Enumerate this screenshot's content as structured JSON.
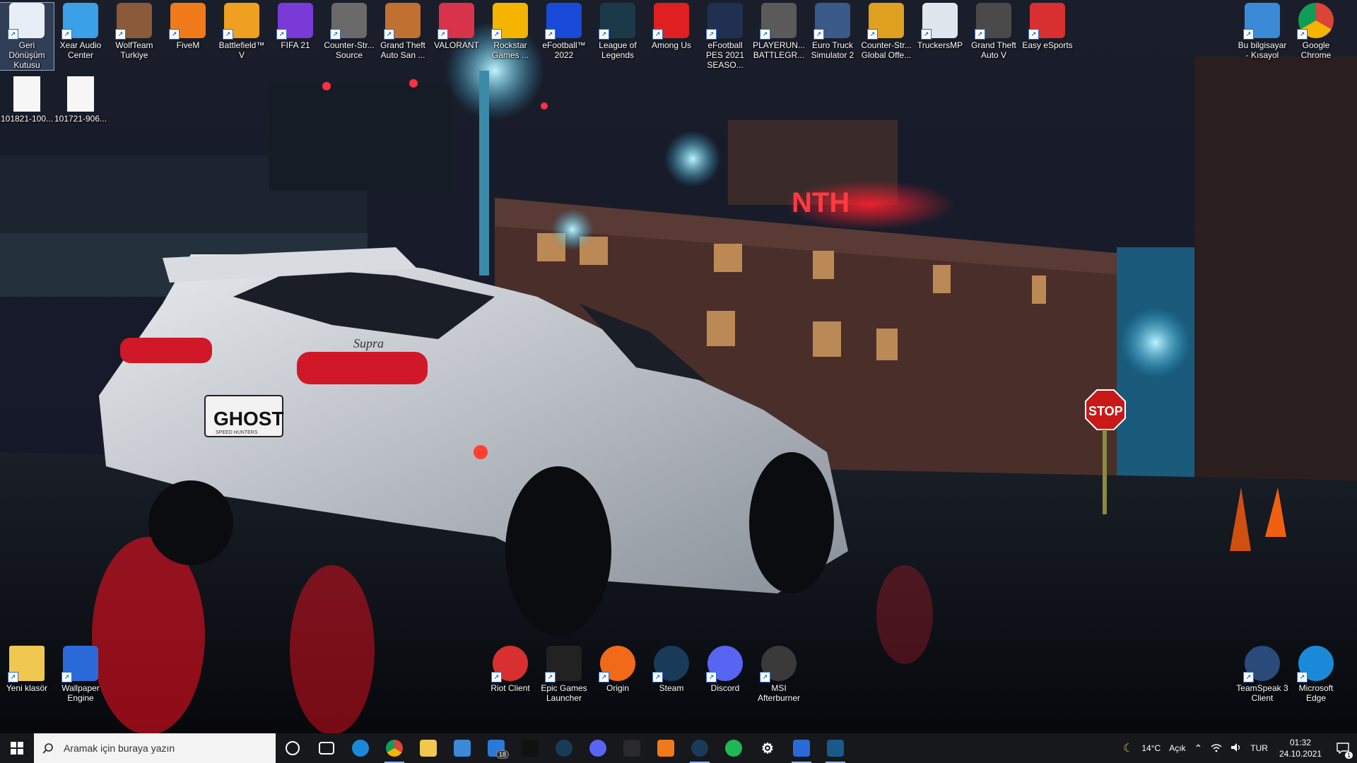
{
  "desktop": {
    "top_icons": [
      {
        "label": "Geri Dönüşüm Kutusu",
        "icon": "recycle-bin-icon",
        "color": "#e8eef5"
      },
      {
        "label": "Xear Audio Center",
        "icon": "xear-audio-icon",
        "color": "#3aa0e8"
      },
      {
        "label": "WolfTeam Turkiye",
        "icon": "wolfteam-icon",
        "color": "#8a5a3a"
      },
      {
        "label": "FiveM",
        "icon": "fivem-icon",
        "color": "#f07a1a"
      },
      {
        "label": "Battlefield™ V",
        "icon": "battlefield-icon",
        "color": "#f0a020"
      },
      {
        "label": "FIFA 21",
        "icon": "fifa-icon",
        "color": "#7a3ad8"
      },
      {
        "label": "Counter-Str... Source",
        "icon": "counter-strike-source-icon",
        "color": "#6a6a6a"
      },
      {
        "label": "Grand Theft Auto San ...",
        "icon": "gta-san-andreas-icon",
        "color": "#c07030"
      },
      {
        "label": "VALORANT",
        "icon": "valorant-icon",
        "color": "#d8334a"
      },
      {
        "label": "Rockstar Games ...",
        "icon": "rockstar-games-icon",
        "color": "#f5b400"
      },
      {
        "label": "eFootball™ 2022",
        "icon": "efootball-icon",
        "color": "#1a4ad8"
      },
      {
        "label": "League of Legends",
        "icon": "league-of-legends-icon",
        "color": "#1a3a4a"
      },
      {
        "label": "Among Us",
        "icon": "among-us-icon",
        "color": "#e02020"
      },
      {
        "label": "eFootball PES 2021 SEASO...",
        "icon": "pes-2021-icon",
        "color": "#203050"
      },
      {
        "label": "PLAYERUN... BATTLEGR...",
        "icon": "pubg-icon",
        "color": "#5a5a5a"
      },
      {
        "label": "Euro Truck Simulator 2",
        "icon": "euro-truck-icon",
        "color": "#3a5a8a"
      },
      {
        "label": "Counter-Str... Global Offe...",
        "icon": "csgo-icon",
        "color": "#e0a020"
      },
      {
        "label": "TruckersMP",
        "icon": "truckersmp-icon",
        "color": "#dfe6ee"
      },
      {
        "label": "Grand Theft Auto V",
        "icon": "gta-v-icon",
        "color": "#4a4a4a"
      },
      {
        "label": "Easy eSports",
        "icon": "easy-esports-icon",
        "color": "#d83030"
      }
    ],
    "right_icons": [
      {
        "label": "Bu bilgisayar - Kısayol",
        "icon": "this-pc-icon",
        "color": "#3a8ad8"
      },
      {
        "label": "Google Chrome",
        "icon": "chrome-icon",
        "color": "#ffffff"
      }
    ],
    "file_icons": [
      {
        "label": "101821-100...",
        "icon": "file-icon"
      },
      {
        "label": "101721-906...",
        "icon": "file-icon"
      }
    ],
    "bottom_left_icons": [
      {
        "label": "Yeni klasör",
        "icon": "folder-icon",
        "color": "#f0c850"
      },
      {
        "label": "Wallpaper Engine",
        "icon": "wallpaper-engine-icon",
        "color": "#2a6ad8"
      }
    ],
    "bottom_center_icons": [
      {
        "label": "Riot Client",
        "icon": "riot-client-icon",
        "color": "#d83030"
      },
      {
        "label": "Epic Games Launcher",
        "icon": "epic-games-icon",
        "color": "#222222"
      },
      {
        "label": "Origin",
        "icon": "origin-icon",
        "color": "#f06a1a"
      },
      {
        "label": "Steam",
        "icon": "steam-icon",
        "color": "#1a3a5a"
      },
      {
        "label": "Discord",
        "icon": "discord-icon",
        "color": "#5865f2"
      },
      {
        "label": "MSI Afterburner",
        "icon": "msi-afterburner-icon",
        "color": "#3a3a3a"
      }
    ],
    "bottom_right_icons": [
      {
        "label": "TeamSpeak 3 Client",
        "icon": "teamspeak-icon",
        "color": "#2a4a7a"
      },
      {
        "label": "Microsoft Edge",
        "icon": "edge-icon",
        "color": "#1a8ad8"
      }
    ],
    "wallpaper_texts": {
      "plate": "GHOST",
      "plate_sub": "SPEED HUNTERS",
      "stop": "STOP",
      "sign": "NTH",
      "brand": "Supra"
    }
  },
  "taskbar": {
    "search_placeholder": "Aramak için buraya yazın",
    "apps": [
      {
        "icon": "cortana-icon",
        "color": "#16181c"
      },
      {
        "icon": "task-view-icon",
        "color": "#16181c"
      },
      {
        "icon": "edge-icon",
        "color": "#1a8ad8"
      },
      {
        "icon": "chrome-icon",
        "color": "#e8e8e8",
        "active": true
      },
      {
        "icon": "file-explorer-icon",
        "color": "#f0c850"
      },
      {
        "icon": "microsoft-store-icon",
        "color": "#3a8ad8"
      },
      {
        "icon": "mail-icon",
        "color": "#2a7ad8",
        "badge": "18"
      },
      {
        "icon": "netflix-icon",
        "color": "#111111"
      },
      {
        "icon": "steam-icon",
        "color": "#1a3a5a"
      },
      {
        "icon": "discord-icon",
        "color": "#5865f2"
      },
      {
        "icon": "xbox-icon",
        "color": "#2a2a2a"
      },
      {
        "icon": "fivem-icon",
        "color": "#f07a1a"
      },
      {
        "icon": "steam-icon",
        "color": "#1a3a5a",
        "active": true
      },
      {
        "icon": "spotify-icon",
        "color": "#1db954"
      },
      {
        "icon": "settings-icon",
        "color": "#16181c"
      },
      {
        "icon": "wallpaper-engine-icon",
        "color": "#2a6ad8",
        "active": true
      },
      {
        "icon": "network-tool-icon",
        "color": "#1a5a8a",
        "active": true
      }
    ],
    "tray": {
      "weather_temp": "14°C",
      "weather_text": "Açık",
      "language": "TUR",
      "time": "01:32",
      "date": "24.10.2021",
      "notification_count": "1"
    }
  }
}
